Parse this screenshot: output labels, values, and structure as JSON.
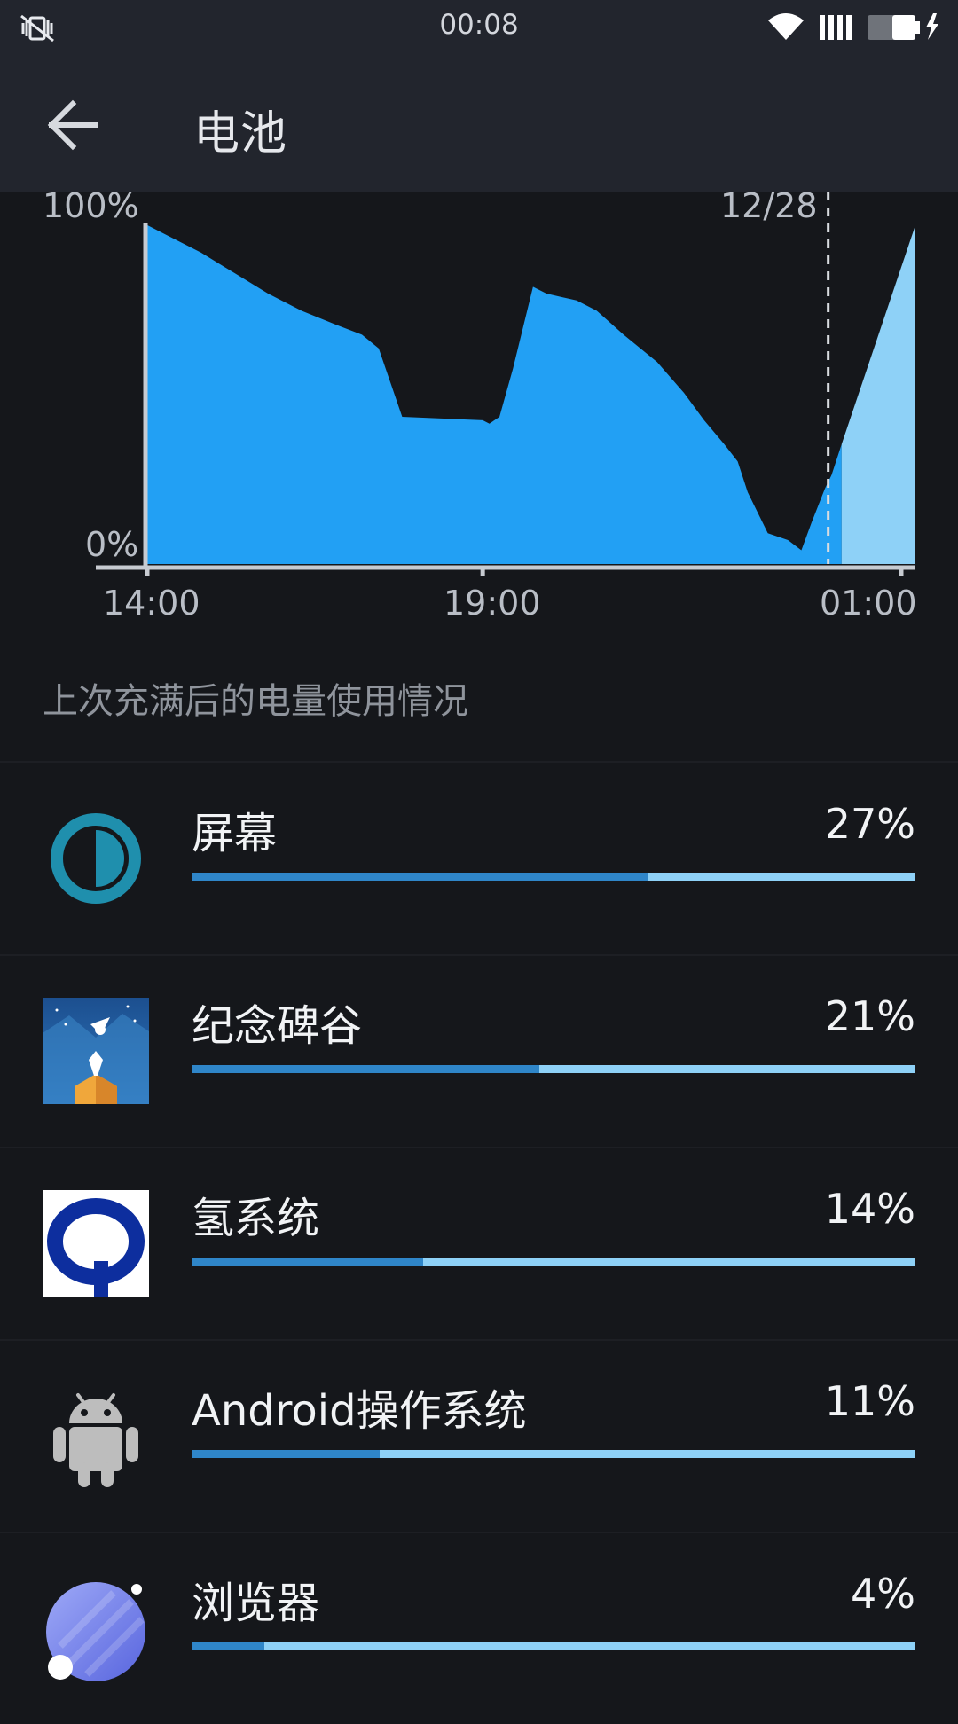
{
  "status_bar": {
    "time": "00:08",
    "icons": [
      "mute-vibrate-icon",
      "wifi-icon",
      "signal-icon",
      "battery-charging-icon"
    ]
  },
  "toolbar": {
    "title": "电池",
    "back_icon": "arrow-left-icon"
  },
  "chart_data": {
    "type": "area",
    "title": "",
    "y_labels": [
      "100%",
      "0%"
    ],
    "x_labels": [
      "14:00",
      "19:00",
      "01:00"
    ],
    "date_marker": "12/28",
    "ylim": [
      0,
      100
    ],
    "series": [
      {
        "type": "discharge",
        "color": "#22a0f4",
        "points": [
          [
            14.0,
            99
          ],
          [
            14.3,
            96
          ],
          [
            14.8,
            91
          ],
          [
            15.3,
            85
          ],
          [
            15.8,
            79
          ],
          [
            16.3,
            74
          ],
          [
            16.8,
            70
          ],
          [
            17.2,
            67
          ],
          [
            17.45,
            63
          ],
          [
            17.8,
            43
          ],
          [
            19.0,
            42
          ],
          [
            19.1,
            41
          ],
          [
            19.25,
            43
          ],
          [
            19.45,
            57
          ],
          [
            19.75,
            81
          ],
          [
            19.95,
            79
          ],
          [
            20.4,
            77
          ],
          [
            20.7,
            74
          ],
          [
            21.1,
            67
          ],
          [
            21.6,
            59
          ],
          [
            22.0,
            50
          ],
          [
            22.3,
            42
          ],
          [
            22.6,
            35
          ],
          [
            22.8,
            30
          ],
          [
            22.95,
            21
          ],
          [
            23.25,
            9
          ],
          [
            23.55,
            7
          ],
          [
            23.75,
            4
          ],
          [
            23.9,
            12
          ],
          [
            24.1,
            22
          ],
          [
            24.2,
            26
          ],
          [
            24.35,
            35
          ]
        ]
      },
      {
        "type": "projection",
        "color": "#8ed1f7",
        "points": [
          [
            24.35,
            35
          ],
          [
            25.45,
            99
          ]
        ]
      }
    ],
    "xlim": [
      14.0,
      25.45
    ],
    "date_marker_x": 24.15,
    "x_tick_values": [
      14,
      19,
      25.45
    ]
  },
  "section_header": "上次充满后的电量使用情况",
  "usage_items": [
    {
      "name": "屏幕",
      "percent": "27%",
      "fraction": 0.63,
      "icon": "screen-brightness-icon"
    },
    {
      "name": "纪念碑谷",
      "percent": "21%",
      "fraction": 0.48,
      "icon": "monument-valley-app-icon"
    },
    {
      "name": "氢系统",
      "percent": "14%",
      "fraction": 0.32,
      "icon": "hydrogen-os-app-icon"
    },
    {
      "name": "Android操作系统",
      "percent": "11%",
      "fraction": 0.26,
      "icon": "android-robot-icon"
    },
    {
      "name": "浏览器",
      "percent": "4%",
      "fraction": 0.1,
      "icon": "browser-app-icon"
    }
  ]
}
